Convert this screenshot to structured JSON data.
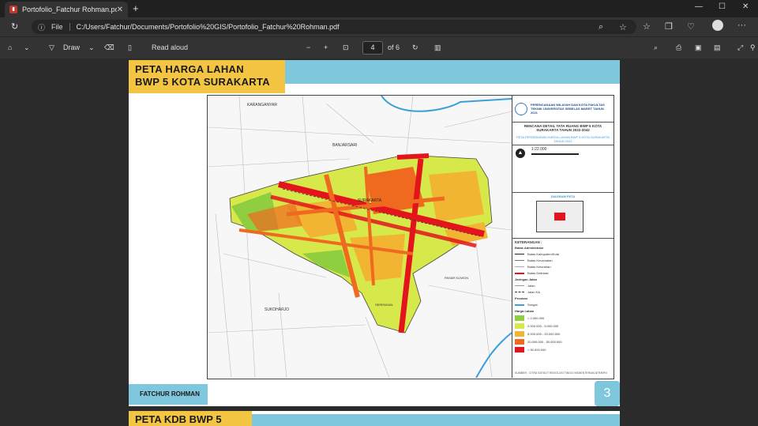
{
  "browser": {
    "tab_title": "Portofolio_Fatchur Rohman.pdf",
    "address_label": "File",
    "url": "C:/Users/Fatchur/Documents/Portofolio%20GIS/Portofolio_Fatchur%20Rohman.pdf"
  },
  "pdf_toolbar": {
    "draw_label": "Draw",
    "read_aloud_label": "Read aloud",
    "page_current": "4",
    "page_total": "of 6"
  },
  "page": {
    "title_line1": "PETA HARGA LAHAN",
    "title_line2": "BWP 5 KOTA SURAKARTA",
    "author": "FATCHUR ROHMAN",
    "page_number": "3"
  },
  "map": {
    "labels": {
      "karanganyar": "KARANGANYAR",
      "banjarsari": "BANJARSARI",
      "surakarta": "SURAKARTA",
      "sukoharjo": "SUKOHARJO",
      "serengan": "SERENGAN",
      "pasar_kliwon": "PASAR KLIWON"
    },
    "legend": {
      "institution": "PERENCANAAN WILAYAH DAN KOTA FAKULTAS TEKNIK UNIVERSITAS SEBELAS MARET TAHUN 2021",
      "plan_title": "RENCANA DETAIL TATA RUANG BWP 5 KOTA SURAKARTA TAHUN 2022-2042",
      "map_title": "PETA PERSEBARAN HARGA LAHAN BWP 5 KOTA SURAKARTA TAHUN 2021",
      "scale": "1:22.000",
      "inset_title": "DIAGRAM PETA",
      "keterangan": "KETERANGAN :",
      "batas_admin": "Batas Administrasi",
      "admin_items": [
        "Batas Kabupaten/Kota",
        "Batas Kecamatan",
        "Batas Kelurahan",
        "Batas Deliniasi"
      ],
      "jaringan": "Jaringan Jalan",
      "jalan_items": [
        "Jalan",
        "Jalan KA"
      ],
      "perairan": "Perairan",
      "perairan_items": [
        "Sungai"
      ],
      "harga": "Harga Lahan",
      "harga_items": [
        {
          "label": "< 2.000.000",
          "color": "#8fce3e"
        },
        {
          "label": "2.000.000 - 5.000.000",
          "color": "#d6e84a"
        },
        {
          "label": "5.000.000 - 20.000.000",
          "color": "#f2b533"
        },
        {
          "label": "20.000.000 - 50.000.000",
          "color": "#ef6a1f"
        },
        {
          "label": "> 50.000.000",
          "color": "#e3141b"
        }
      ],
      "source": "SUMBER : CITRA SATELIT RESOLUSI TINGGI KEMENTERIAN ATR/BPN"
    }
  },
  "next_page": {
    "title": "PETA KDB BWP 5"
  }
}
